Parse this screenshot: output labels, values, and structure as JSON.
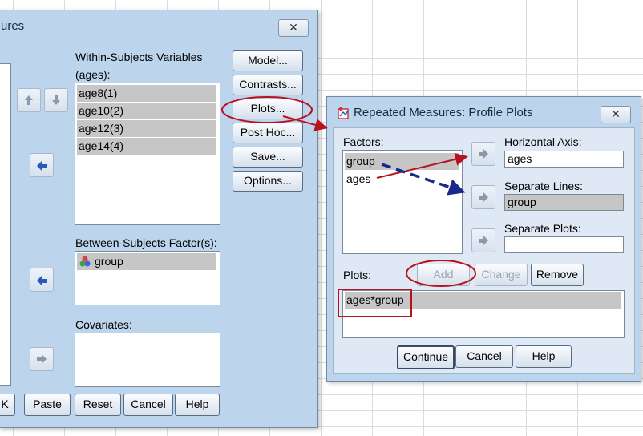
{
  "main_dialog": {
    "title": "ures",
    "within_label": "Within-Subjects Variables",
    "within_factor": "(ages):",
    "within_items": [
      "age8(1)",
      "age10(2)",
      "age12(3)",
      "age14(4)"
    ],
    "between_label": "Between-Subjects Factor(s):",
    "between_items": [
      "group"
    ],
    "covariates_label": "Covariates:",
    "side_buttons": {
      "model": "Model...",
      "contrasts": "Contrasts...",
      "plots": "Plots...",
      "posthoc": "Post Hoc...",
      "save": "Save...",
      "options": "Options..."
    },
    "bottom_buttons": {
      "ok": "K",
      "paste": "Paste",
      "reset": "Reset",
      "cancel": "Cancel",
      "help": "Help"
    }
  },
  "profile_dialog": {
    "title": "Repeated Measures: Profile Plots",
    "factors_label": "Factors:",
    "factors": [
      "group",
      "ages"
    ],
    "horizontal_axis_label": "Horizontal Axis:",
    "horizontal_axis_value": "ages",
    "separate_lines_label": "Separate Lines:",
    "separate_lines_value": "group",
    "separate_plots_label": "Separate Plots:",
    "separate_plots_value": "",
    "plots_label": "Plots:",
    "add": "Add",
    "change": "Change",
    "remove": "Remove",
    "plots_items": [
      "ages*group"
    ],
    "continue": "Continue",
    "cancel": "Cancel",
    "help": "Help"
  },
  "colors": {
    "annotation_red": "#b8121f",
    "annotation_blue": "#1a2a8c"
  }
}
